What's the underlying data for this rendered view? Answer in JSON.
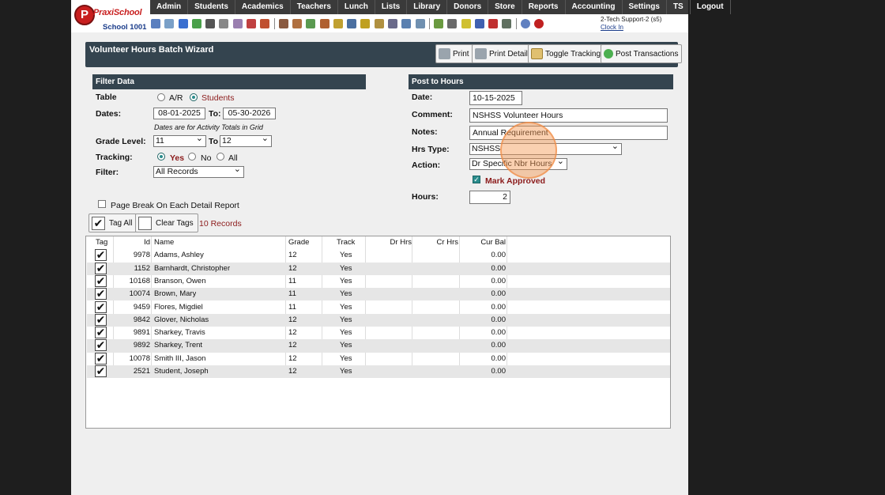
{
  "header": {
    "logo_initial": "P",
    "logo_name": "PraxiSchool",
    "school": "School 1001",
    "menu": [
      "Admin",
      "Students",
      "Academics",
      "Teachers",
      "Lunch",
      "Lists",
      "Library",
      "Donors",
      "Store",
      "Reports",
      "Accounting",
      "Settings",
      "TS",
      "Logout"
    ],
    "user": "2-Tech Support-2 (s5)",
    "clock_in": "Clock In"
  },
  "toolbar_icons": [
    "magnifier-icon",
    "table-icon",
    "at-icon",
    "chat-icon",
    "phone-icon",
    "speaker-icon",
    "notes-icon",
    "calendar-icon",
    "megaphone-icon",
    "person-icon",
    "people-icon",
    "money-icon",
    "bus-icon",
    "meal-icon",
    "book-icon",
    "pencil-icon",
    "scroll-icon",
    "user-icon",
    "clock-icon",
    "grid-icon",
    "card-icon",
    "scanner-icon",
    "barcode-icon",
    "ap-icon",
    "pdf-icon",
    "server-icon",
    "help-icon",
    "power-icon"
  ],
  "wizard": {
    "title": "Volunteer Hours Batch Wizard",
    "buttons": [
      "Print",
      "Print Detail",
      "Toggle Tracking",
      "Post Transactions"
    ]
  },
  "filter": {
    "heading": "Filter Data",
    "table_label": "Table",
    "table_opt1": "A/R",
    "table_opt2": "Students",
    "dates_label": "Dates:",
    "date_from": "08-01-2025",
    "to1": "To:",
    "date_to": "05-30-2026",
    "dates_note": "Dates are for Activity Totals in Grid",
    "grade_label": "Grade Level:",
    "grade_from": "11",
    "to2": "To",
    "grade_to": "12",
    "tracking_label": "Tracking:",
    "track_yes": "Yes",
    "track_no": "No",
    "track_all": "All",
    "filter_label": "Filter:",
    "filter_value": "All Records",
    "page_break": "Page Break On Each Detail Report",
    "tag_all": "Tag All",
    "clear_tags": "Clear Tags",
    "record_count": "10 Records"
  },
  "post": {
    "heading": "Post to Hours",
    "date_label": "Date:",
    "date": "10-15-2025",
    "comment_label": "Comment:",
    "comment": "NSHSS Volunteer Hours",
    "notes_label": "Notes:",
    "notes": "Annual Requirement",
    "hrs_type_label": "Hrs Type:",
    "hrs_type": "NSHSS",
    "action_label": "Action:",
    "action": "Dr Specific Nbr Hours",
    "mark_approved": "Mark Approved",
    "hours_label": "Hours:",
    "hours": "2"
  },
  "grid": {
    "columns": [
      "Tag",
      "Id",
      "Name",
      "Grade",
      "Track",
      "Dr Hrs",
      "Cr Hrs",
      "Cur Bal"
    ],
    "rows": [
      {
        "id": "9978",
        "name": "Adams, Ashley",
        "grade": "12",
        "track": "Yes",
        "bal": "0.00"
      },
      {
        "id": "1152",
        "name": "Barnhardt, Christopher",
        "grade": "12",
        "track": "Yes",
        "bal": "0.00"
      },
      {
        "id": "10168",
        "name": "Branson, Owen",
        "grade": "11",
        "track": "Yes",
        "bal": "0.00"
      },
      {
        "id": "10074",
        "name": "Brown, Mary",
        "grade": "11",
        "track": "Yes",
        "bal": "0.00"
      },
      {
        "id": "9459",
        "name": "Flores, Migdiel",
        "grade": "11",
        "track": "Yes",
        "bal": "0.00"
      },
      {
        "id": "9842",
        "name": "Glover, Nicholas",
        "grade": "12",
        "track": "Yes",
        "bal": "0.00"
      },
      {
        "id": "9891",
        "name": "Sharkey, Travis",
        "grade": "12",
        "track": "Yes",
        "bal": "0.00"
      },
      {
        "id": "9892",
        "name": "Sharkey, Trent",
        "grade": "12",
        "track": "Yes",
        "bal": "0.00"
      },
      {
        "id": "10078",
        "name": "Smith III, Jason",
        "grade": "12",
        "track": "Yes",
        "bal": "0.00"
      },
      {
        "id": "2521",
        "name": "Student, Joseph",
        "grade": "12",
        "track": "Yes",
        "bal": "0.00"
      }
    ]
  },
  "colors": {
    "header_bg": "#34444f",
    "menu_bg": "#3a3a3a",
    "accent_teal": "#2a8c8c",
    "brand_red": "#c81e1e"
  }
}
